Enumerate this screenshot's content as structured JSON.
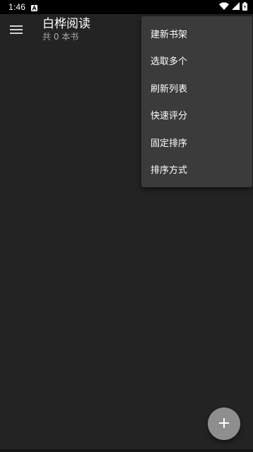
{
  "status_bar": {
    "time": "1:46",
    "notification_icon": "android-a-icon",
    "icons": [
      "wifi-icon",
      "signal-icon",
      "battery-icon"
    ]
  },
  "app_bar": {
    "menu_icon": "hamburger-menu-icon",
    "title": "白桦阅读",
    "subtitle": "共 0 本书"
  },
  "popup_menu": {
    "items": [
      {
        "label": "建新书架"
      },
      {
        "label": "选取多个"
      },
      {
        "label": "刷新列表"
      },
      {
        "label": "快速评分"
      },
      {
        "label": "固定排序"
      },
      {
        "label": "排序方式"
      }
    ]
  },
  "fab": {
    "icon": "plus-icon"
  },
  "colors": {
    "background": "#232323",
    "status_bar": "#000000",
    "popup": "#3b3b3b",
    "fab": "#8e8e8e",
    "text_primary": "#ffffff",
    "text_secondary": "#a8a8a8"
  }
}
